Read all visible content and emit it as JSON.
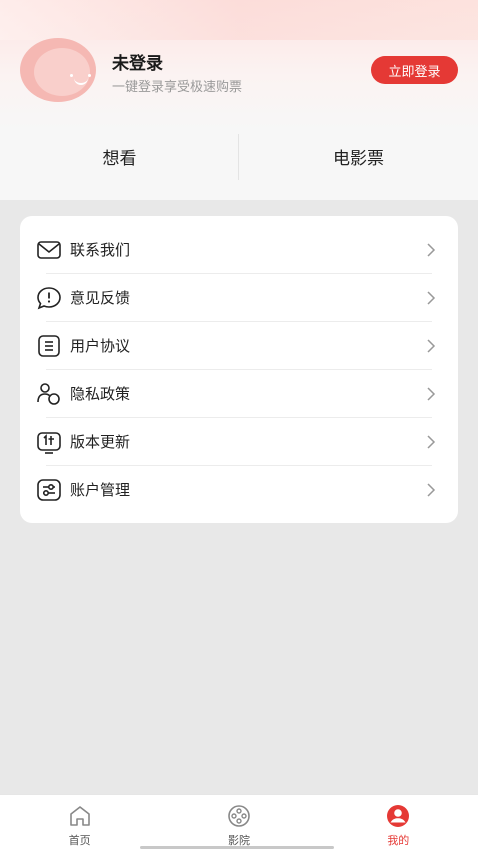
{
  "profile": {
    "name": "未登录",
    "subtitle": "一键登录享受极速购票",
    "login_button": "立即登录"
  },
  "quick_tabs": [
    {
      "label": "想看"
    },
    {
      "label": "电影票"
    }
  ],
  "menu": {
    "items": [
      {
        "label": "联系我们",
        "icon": "mail-icon"
      },
      {
        "label": "意见反馈",
        "icon": "feedback-icon"
      },
      {
        "label": "用户协议",
        "icon": "document-icon"
      },
      {
        "label": "隐私政策",
        "icon": "privacy-icon"
      },
      {
        "label": "版本更新",
        "icon": "update-icon"
      },
      {
        "label": "账户管理",
        "icon": "account-settings-icon"
      }
    ]
  },
  "tabbar": {
    "items": [
      {
        "label": "首页",
        "icon": "home-icon",
        "active": false
      },
      {
        "label": "影院",
        "icon": "cinema-reel-icon",
        "active": false
      },
      {
        "label": "我的",
        "icon": "profile-icon",
        "active": true
      }
    ]
  },
  "colors": {
    "accent": "#e53935",
    "background": "#e8e8e8",
    "card": "#ffffff"
  }
}
